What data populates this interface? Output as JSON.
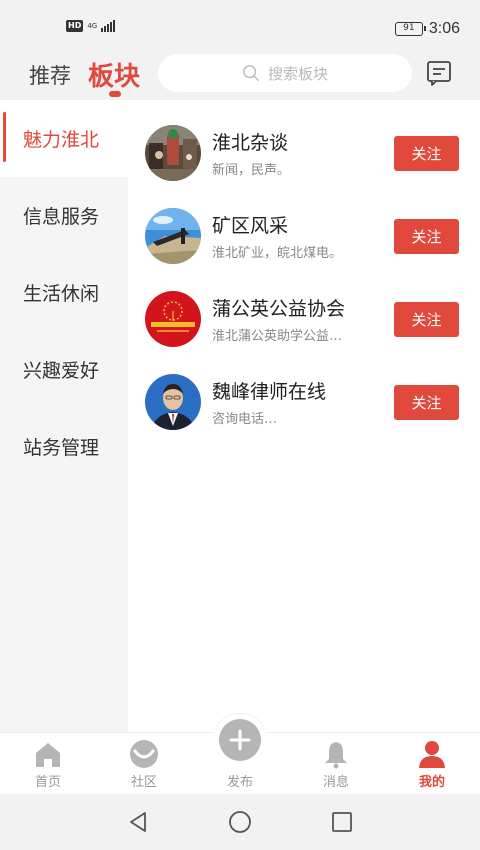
{
  "status_bar": {
    "hd": "HD",
    "network": "4G",
    "battery": "91",
    "time": "3:06"
  },
  "header": {
    "tab_recommend": "推荐",
    "tab_boards": "板块",
    "search_placeholder": "搜索板块",
    "accent_color": "#e0493c"
  },
  "sidebar": {
    "items": [
      {
        "label": "魅力淮北",
        "active": true
      },
      {
        "label": "信息服务",
        "active": false
      },
      {
        "label": "生活休闲",
        "active": false
      },
      {
        "label": "兴趣爱好",
        "active": false
      },
      {
        "label": "站务管理",
        "active": false
      }
    ]
  },
  "boards": [
    {
      "name": "淮北杂谈",
      "desc": "新闻，民声。",
      "follow": "关注",
      "icon": "street-photo-avatar"
    },
    {
      "name": "矿区风采",
      "desc": "淮北矿业，皖北煤电。",
      "follow": "关注",
      "icon": "mine-photo-avatar"
    },
    {
      "name": "蒲公英公益协会",
      "desc": "淮北蒲公英助学公益…",
      "follow": "关注",
      "icon": "charity-logo-avatar"
    },
    {
      "name": "魏峰律师在线",
      "desc": "咨询电话…",
      "follow": "关注",
      "icon": "lawyer-portrait-avatar"
    }
  ],
  "bottom_nav": {
    "items": [
      {
        "label": "首页",
        "icon": "home-icon"
      },
      {
        "label": "社区",
        "icon": "community-icon"
      },
      {
        "label": "发布",
        "icon": "plus-icon"
      },
      {
        "label": "消息",
        "icon": "bell-icon"
      },
      {
        "label": "我的",
        "icon": "user-icon",
        "active": true
      }
    ]
  }
}
